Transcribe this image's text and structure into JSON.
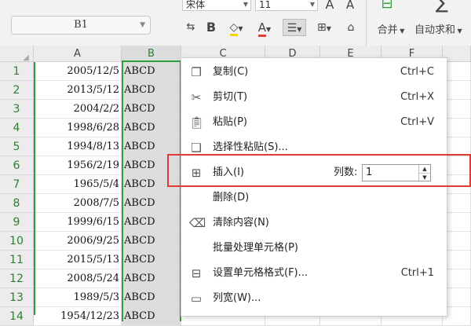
{
  "toolbar": {
    "name_box": "B1",
    "font_name": "宋体",
    "font_size": "11",
    "increase_font": "A",
    "decrease_font": "A",
    "bold": "B",
    "merge_label": "合并",
    "autosum_label": "自动求和",
    "sum_symbol": "∑"
  },
  "columns": [
    "A",
    "B",
    "C",
    "D",
    "E",
    "F"
  ],
  "rows": [
    {
      "num": "1",
      "a": "2005/12/5",
      "b": "ABCD"
    },
    {
      "num": "2",
      "a": "2013/5/12",
      "b": "ABCD"
    },
    {
      "num": "3",
      "a": "2004/2/2",
      "b": "ABCD"
    },
    {
      "num": "4",
      "a": "1998/6/28",
      "b": "ABCD"
    },
    {
      "num": "5",
      "a": "1994/8/13",
      "b": "ABCD"
    },
    {
      "num": "6",
      "a": "1956/2/19",
      "b": "ABCD"
    },
    {
      "num": "7",
      "a": "1965/5/4",
      "b": "ABCD"
    },
    {
      "num": "8",
      "a": "2008/7/5",
      "b": "ABCD"
    },
    {
      "num": "9",
      "a": "1999/6/15",
      "b": "ABCD"
    },
    {
      "num": "10",
      "a": "2006/9/25",
      "b": "ABCD"
    },
    {
      "num": "11",
      "a": "2015/5/13",
      "b": "ABCD"
    },
    {
      "num": "12",
      "a": "2008/5/24",
      "b": "ABCD"
    },
    {
      "num": "13",
      "a": "1989/5/3",
      "b": "ABCD"
    },
    {
      "num": "14",
      "a": "1954/12/23",
      "b": "ABCD"
    }
  ],
  "context_menu": {
    "items": [
      {
        "label": "复制(C)",
        "shortcut": "Ctrl+C"
      },
      {
        "label": "剪切(T)",
        "shortcut": "Ctrl+X"
      },
      {
        "label": "粘贴(P)",
        "shortcut": "Ctrl+V"
      },
      {
        "label": "选择性粘贴(S)...",
        "shortcut": ""
      },
      {
        "label": "插入(I)",
        "shortcut": ""
      },
      {
        "label": "删除(D)",
        "shortcut": ""
      },
      {
        "label": "清除内容(N)",
        "shortcut": ""
      },
      {
        "label": "批量处理单元格(P)",
        "shortcut": ""
      },
      {
        "label": "设置单元格格式(F)...",
        "shortcut": "Ctrl+1"
      },
      {
        "label": "列宽(W)...",
        "shortcut": ""
      }
    ],
    "insert_count_label": "列数:",
    "insert_count_value": "1"
  },
  "colors": {
    "selection_green": "#2e9e3e",
    "highlight_red": "#e53935"
  }
}
